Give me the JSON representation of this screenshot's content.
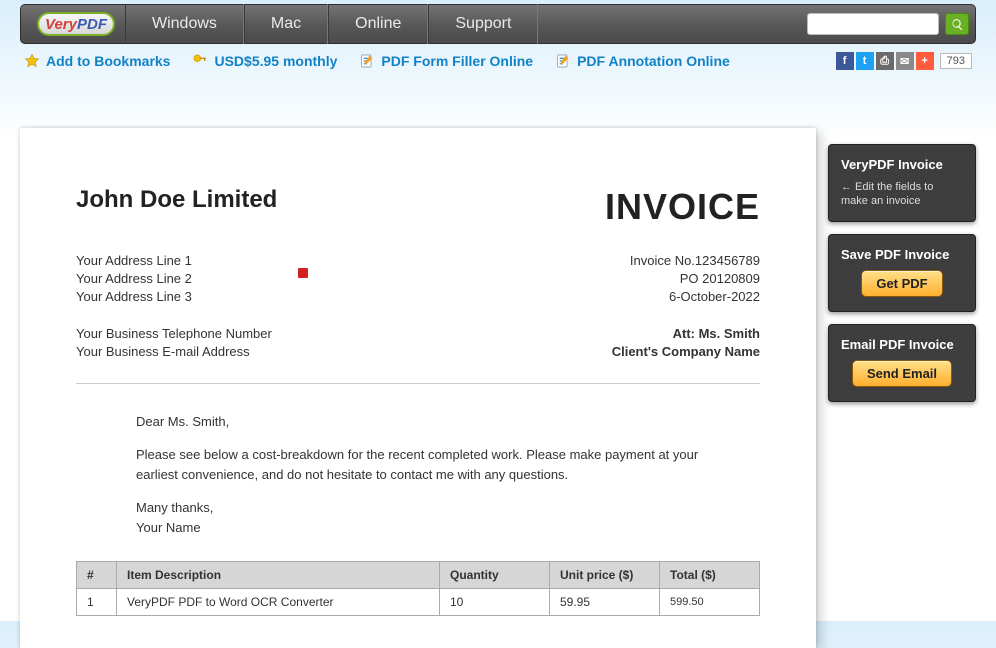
{
  "logo": {
    "part1": "Very",
    "part2": "PDF"
  },
  "nav": {
    "items": [
      "Windows",
      "Mac",
      "Online",
      "Support"
    ]
  },
  "subbar": {
    "bookmarks": "Add to Bookmarks",
    "price": "USD$5.95 monthly",
    "form_filler": "PDF Form Filler Online",
    "annotation": "PDF Annotation Online",
    "share_count": "793"
  },
  "invoice": {
    "company": "John Doe Limited",
    "title": "INVOICE",
    "address": [
      "Your Address Line 1",
      "Your Address Line 2",
      "Your Address Line 3"
    ],
    "meta": [
      "Invoice No.123456789",
      "PO 20120809",
      "6-October-2022"
    ],
    "phone": "Your Business Telephone Number",
    "email": "Your Business E-mail Address",
    "att": "Att: Ms. Smith",
    "client_company": "Client's Company Name",
    "greeting": "Dear Ms. Smith,",
    "body": "Please see below a cost-breakdown for the recent completed work. Please make payment at your earliest convenience, and do not hesitate to contact me with any questions.",
    "thanks": "Many thanks,",
    "signature": "Your Name",
    "table": {
      "headers": [
        "#",
        "Item Description",
        "Quantity",
        "Unit price ($)",
        "Total ($)"
      ],
      "rows": [
        {
          "n": "1",
          "desc": "VeryPDF PDF to Word OCR Converter",
          "qty": "10",
          "unit": "59.95",
          "total": "599.50"
        }
      ]
    }
  },
  "side": {
    "panel1": {
      "title": "VeryPDF Invoice",
      "sub": "← Edit the fields to make an invoice"
    },
    "panel2": {
      "title": "Save PDF Invoice",
      "btn": "Get PDF"
    },
    "panel3": {
      "title": "Email PDF Invoice",
      "btn": "Send Email"
    }
  }
}
